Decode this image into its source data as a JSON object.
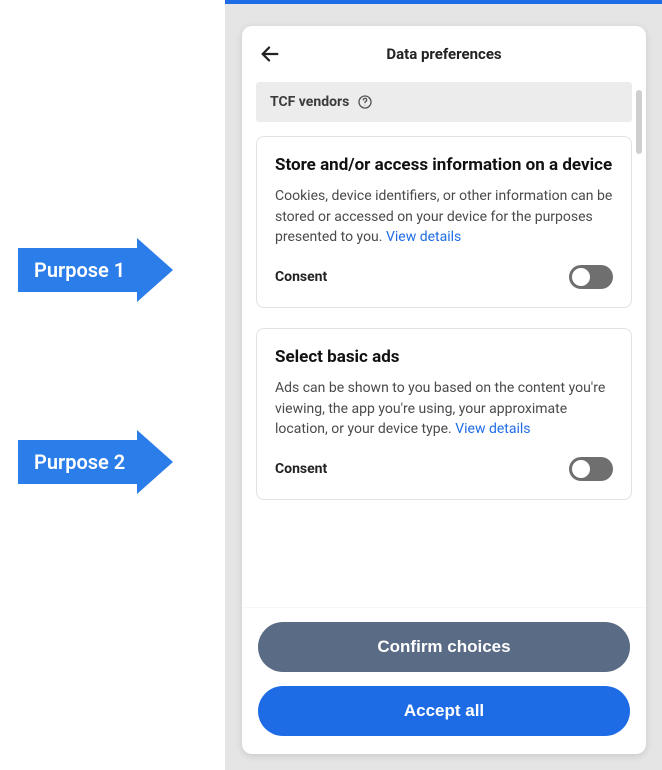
{
  "annotations": {
    "arrow1": "Purpose 1",
    "arrow2": "Purpose 2"
  },
  "modal": {
    "title": "Data preferences",
    "vendors_label": "TCF vendors",
    "view_details_label": "View details",
    "consent_label": "Consent",
    "purposes": [
      {
        "title": "Store and/or access information on a device",
        "description": "Cookies, device identifiers, or other information can be stored or accessed on your device for the purposes presented to you."
      },
      {
        "title": "Select basic ads",
        "description": "Ads can be shown to you based on the content you're viewing, the app you're using, your approximate location, or your device type."
      }
    ],
    "buttons": {
      "confirm": "Confirm choices",
      "accept": "Accept all"
    }
  }
}
